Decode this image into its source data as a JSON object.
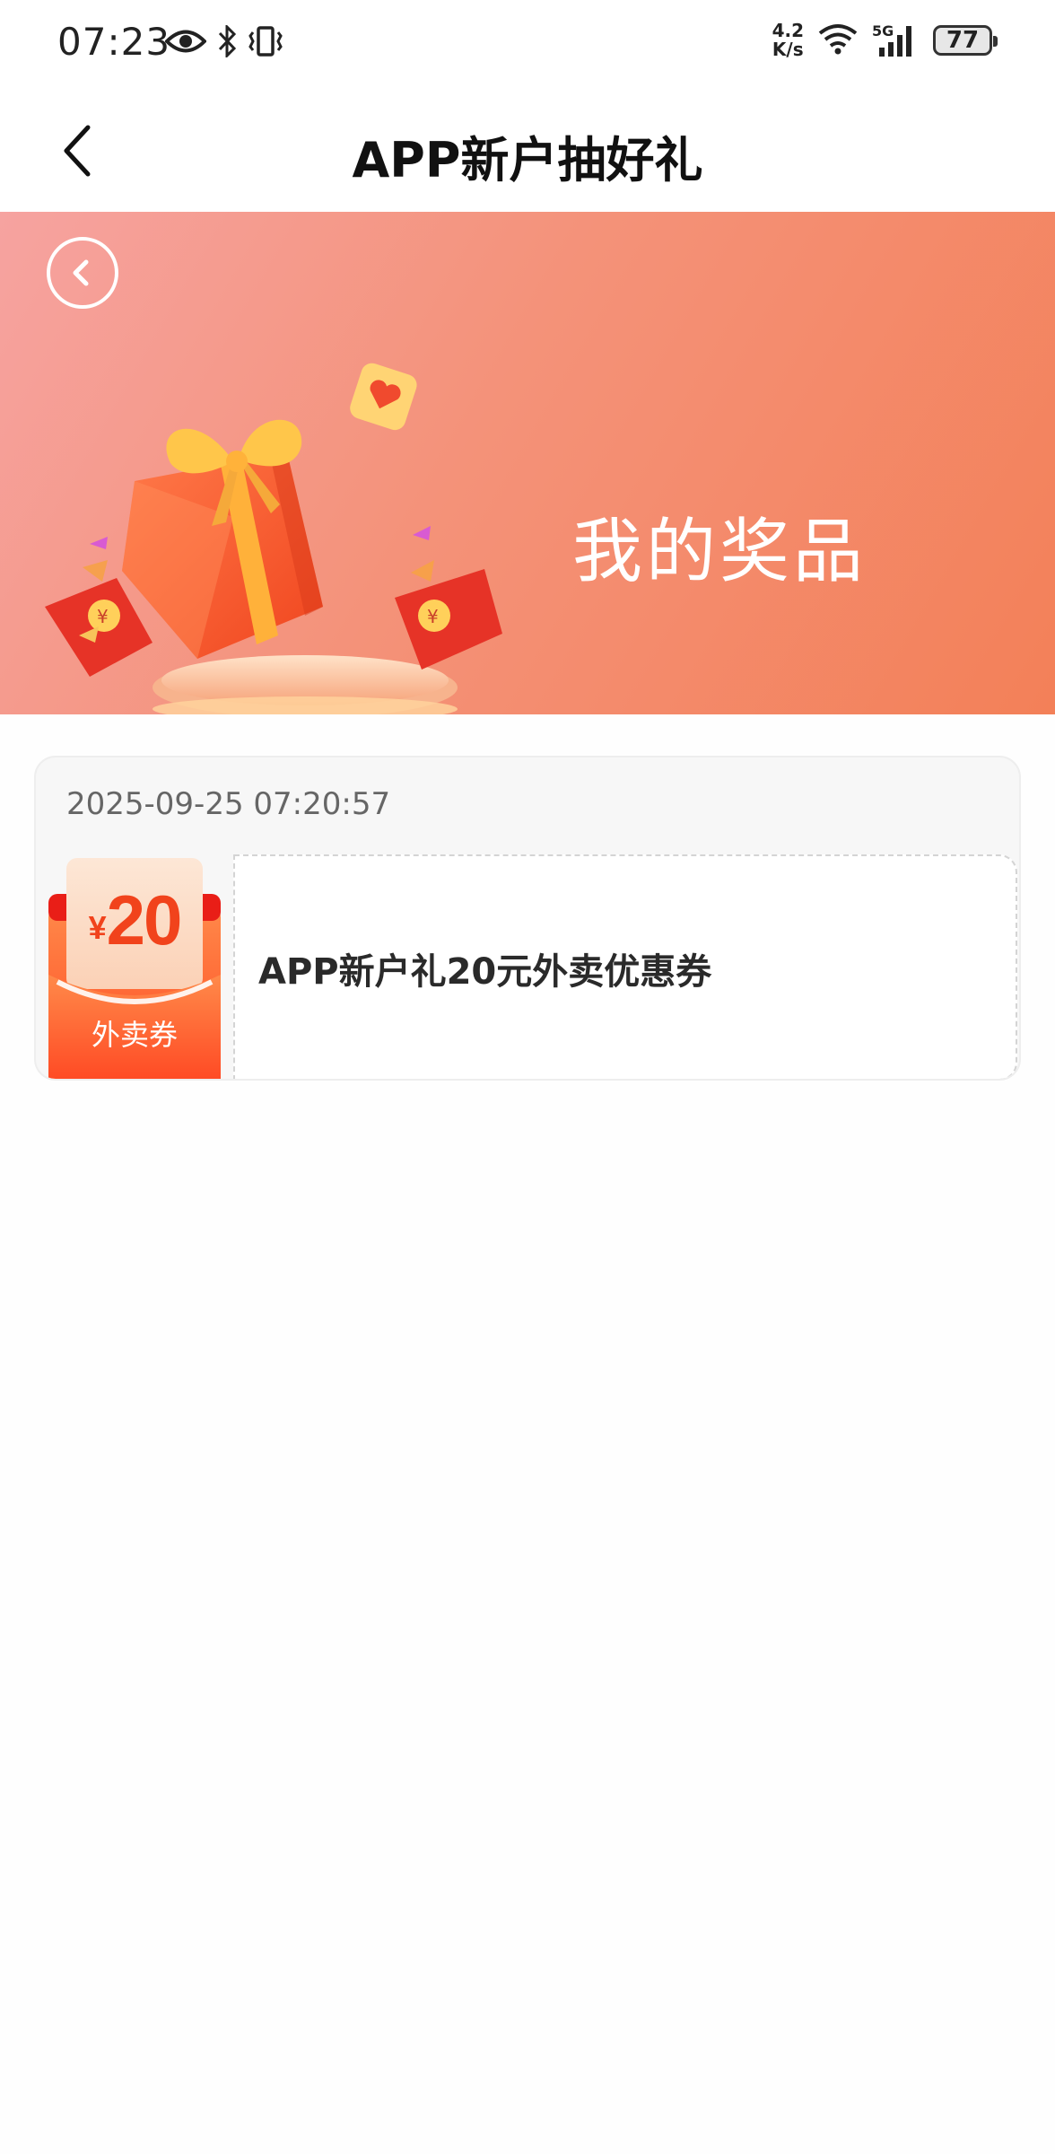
{
  "status_bar": {
    "time": "07:23",
    "net_speed_value": "4.2",
    "net_speed_unit": "K/s",
    "signal_label": "5G",
    "battery": "77",
    "icons": [
      "eye-icon",
      "bluetooth-icon",
      "vibrate-icon",
      "wifi-icon",
      "signal-icon",
      "battery-icon"
    ]
  },
  "nav": {
    "title": "APP新户抽好礼",
    "back_icon": "chevron-left-icon"
  },
  "banner": {
    "title": "我的奖品",
    "back_icon": "circle-chevron-left-icon",
    "colors": {
      "start": "#f6a3a0",
      "end": "#f38058"
    }
  },
  "prizes": [
    {
      "time": "2025-09-25 07:20:57",
      "name": "APP新户礼20元外卖优惠券",
      "coupon": {
        "currency": "¥",
        "amount": "20",
        "type": "外卖券"
      }
    }
  ]
}
